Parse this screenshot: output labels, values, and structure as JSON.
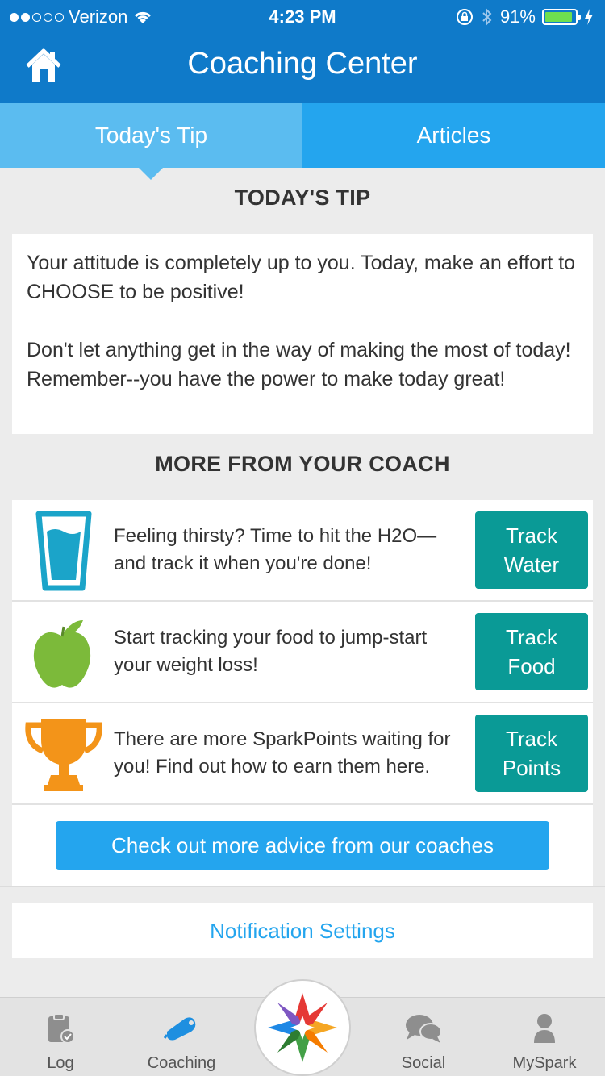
{
  "status_bar": {
    "carrier": "Verizon",
    "time": "4:23 PM",
    "battery": "91%",
    "battery_level": 0.91
  },
  "nav": {
    "title": "Coaching Center"
  },
  "tabs": [
    {
      "label": "Today's Tip",
      "active": true
    },
    {
      "label": "Articles",
      "active": false
    }
  ],
  "todays_tip": {
    "heading": "TODAY'S TIP",
    "paragraphs": [
      "Your attitude is completely up to you. Today, make an effort to CHOOSE to be positive!",
      "Don't let anything get in the way of making the most of today! Remember--you have the power to make today great!"
    ]
  },
  "coach": {
    "heading": "MORE FROM YOUR COACH",
    "items": [
      {
        "icon": "water-glass-icon",
        "text": "Feeling thirsty? Time to hit the H2O—and track it when you're done!",
        "button": "Track Water"
      },
      {
        "icon": "apple-icon",
        "text": "Start tracking your food to jump-start your weight loss!",
        "button": "Track Food"
      },
      {
        "icon": "trophy-icon",
        "text": "There are more SparkPoints waiting for you! Find out how to earn them here.",
        "button": "Track Points"
      }
    ],
    "advice_button": "Check out more advice from our coaches"
  },
  "notification_settings": "Notification Settings",
  "tabbar": {
    "items": [
      {
        "label": "Log",
        "icon": "log-icon"
      },
      {
        "label": "Coaching",
        "icon": "coaching-icon",
        "active": true
      },
      {
        "label": "Social",
        "icon": "social-icon"
      },
      {
        "label": "MySpark",
        "icon": "myspark-icon"
      }
    ]
  },
  "colors": {
    "nav_bg": "#0f7ac9",
    "tab_active": "#5bbcf0",
    "tab_inactive": "#24a5ee",
    "track_button": "#0a9a96",
    "link": "#24a5ee"
  }
}
